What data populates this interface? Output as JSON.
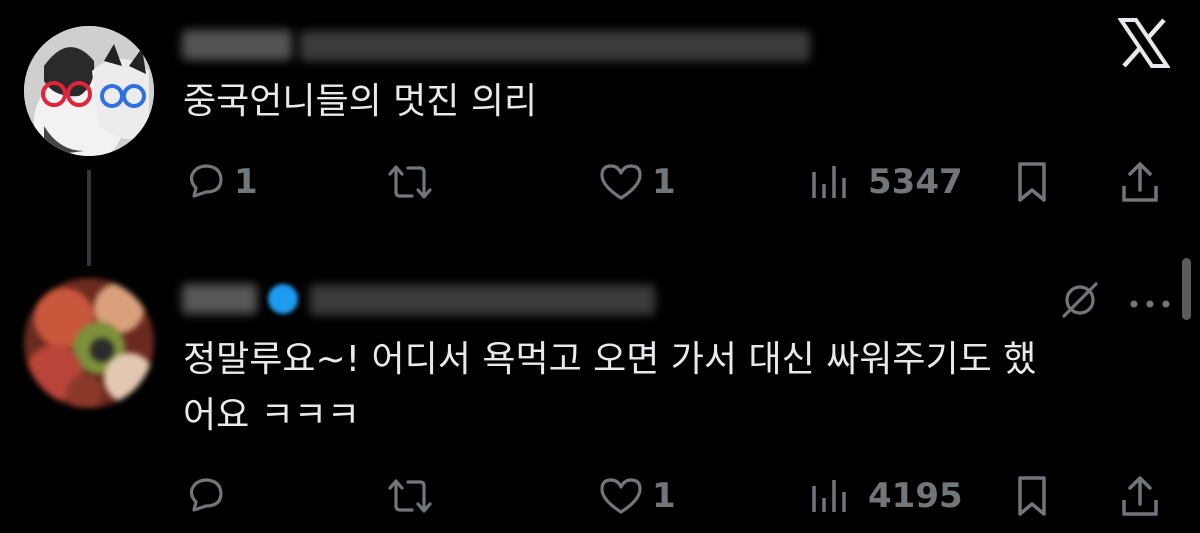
{
  "tweet1": {
    "text": "중국언니들의 멋진 의리",
    "actions": {
      "replies": "1",
      "likes": "1",
      "views": "5347"
    }
  },
  "tweet2": {
    "text_line1": "정말루요~! 어디서 욕먹고 오면 가서 대신 싸워주기도 했",
    "text_line2": "어요 ㅋㅋㅋ",
    "actions": {
      "likes": "1",
      "views": "4195"
    }
  },
  "icons": {
    "close": "x-logo-icon",
    "reply": "comment-icon",
    "retweet": "retweet-icon",
    "like": "heart-icon",
    "views": "views-icon",
    "bookmark": "bookmark-icon",
    "share": "share-icon",
    "grok": "grok-icon",
    "more": "more-icon",
    "verified": "verified-icon"
  },
  "colors": {
    "background": "#000000",
    "text": "#e7e9ea",
    "muted": "#71767b",
    "verified": "#1d9bf0"
  }
}
